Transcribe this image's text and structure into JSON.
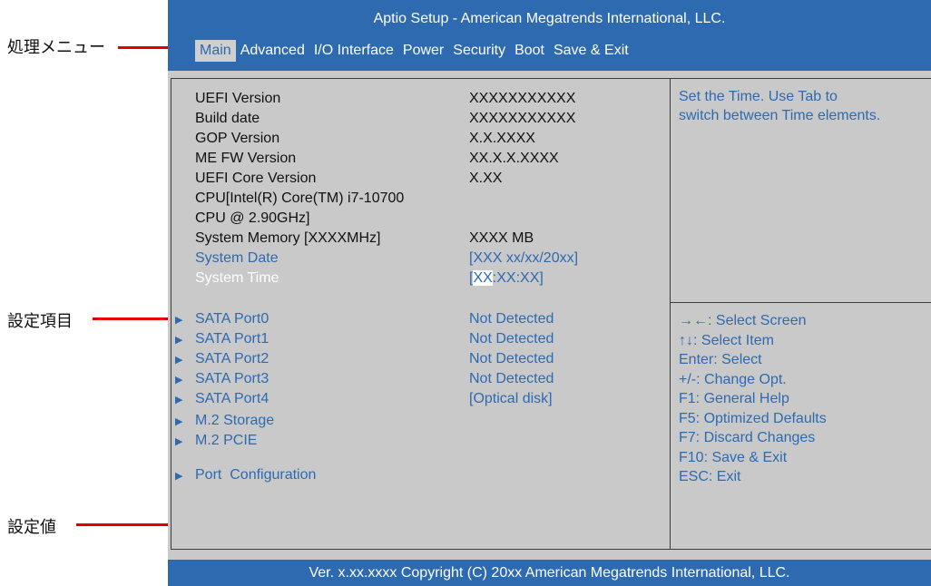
{
  "header": {
    "title": "Aptio Setup - American Megatrends International, LLC.",
    "menu": [
      {
        "label": "Main",
        "active": true
      },
      {
        "label": "Advanced",
        "active": false
      },
      {
        "label": "I/O Interface",
        "active": false
      },
      {
        "label": "Power",
        "active": false
      },
      {
        "label": "Security",
        "active": false
      },
      {
        "label": "Boot",
        "active": false
      },
      {
        "label": "Save & Exit",
        "active": false
      }
    ]
  },
  "info": [
    {
      "label": "UEFI Version",
      "value": "XXXXXXXXXXX"
    },
    {
      "label": "Build date",
      "value": "XXXXXXXXXXX"
    },
    {
      "label": "GOP Version",
      "value": "X.X.XXXX"
    },
    {
      "label": "ME FW Version",
      "value": "XX.X.X.XXXX"
    },
    {
      "label": "UEFI Core Version",
      "value": "X.XX"
    },
    {
      "label": "CPU[Intel(R) Core(TM) i7-10700",
      "value": ""
    },
    {
      "label": "CPU @ 2.90GHz]",
      "value": ""
    },
    {
      "label": "System Memory [XXXXMHz]",
      "value": "XXXX MB"
    }
  ],
  "system_date": {
    "label": "System Date",
    "value": "[XXX xx/xx/20xx]"
  },
  "system_time": {
    "label": "System Time",
    "bracket_open": "[",
    "selected": "XX",
    "rest": ":XX:XX]"
  },
  "submenus": [
    {
      "label": "SATA Port0",
      "value": "Not Detected"
    },
    {
      "label": "SATA Port1",
      "value": "Not Detected"
    },
    {
      "label": "SATA Port2",
      "value": "Not Detected"
    },
    {
      "label": "SATA Port3",
      "value": "Not Detected"
    },
    {
      "label": "SATA Port4",
      "value": "[Optical disk]"
    },
    {
      "label": "M.2 Storage",
      "value": ""
    },
    {
      "label": "M.2 PCIE",
      "value": ""
    },
    {
      "label": "Port  Configuration",
      "value": ""
    }
  ],
  "help": {
    "line1": "Set the Time. Use Tab to",
    "line2": "switch between Time elements."
  },
  "keys": [
    "→←: Select Screen",
    "↑↓: Select Item",
    "Enter: Select",
    "+/-: Change Opt.",
    "F1: General Help",
    "F5: Optimized Defaults",
    "F7: Discard Changes",
    "F10: Save & Exit",
    "ESC: Exit"
  ],
  "footer": "Ver. x.xx.xxxx Copyright (C) 20xx American Megatrends International, LLC.",
  "annotations": {
    "menu": "処理メニュー",
    "items": "設定項目",
    "values": "設定値"
  },
  "colors": {
    "bios_blue": "#2e6ab0",
    "panel_gray": "#c9c9c9",
    "annotation_red": "#e00000"
  }
}
